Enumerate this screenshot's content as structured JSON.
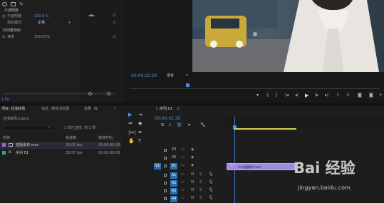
{
  "effect_controls": {
    "opacity_label": "不透明度",
    "opacity_prop": "不透明度",
    "opacity_value": "100.0 %",
    "blend_label": "混合模式",
    "blend_value": "正常",
    "time_remap_label": "时间重映射",
    "speed_label": "速度",
    "speed_value": "100.00%",
    "bottom_time": "1:00"
  },
  "program_monitor": {
    "timecode": "00:00:02:20",
    "fit_label": "适合"
  },
  "project": {
    "tabs": [
      "项目: 丝滑转场",
      "信息",
      "媒体浏览器",
      "效果",
      "库"
    ],
    "path": "丝滑转场.prproj",
    "item_count": "1 项已选择, 共 2 项",
    "col_name": "名称",
    "col_fps": "帧速率",
    "col_start": "媒体开始",
    "items": [
      {
        "name": "拍摄素材.mov",
        "fps": "25.00 fps",
        "start": "00:00:00:00",
        "color": "#8a6fd1"
      },
      {
        "name": "序列 01",
        "fps": "29.97 fps",
        "start": "00:00:00:00",
        "color": "#2aa7a0"
      }
    ]
  },
  "timeline": {
    "tab_label": "序列 01",
    "timecode": "00:00:02:20",
    "clip_label": "fx  拍摄素材.mov",
    "video_tracks": [
      "V3",
      "V2",
      "V1"
    ],
    "audio_tracks": [
      "A1",
      "A2",
      "A3",
      "A4",
      "A5"
    ],
    "source_patch": "V1"
  },
  "watermark": {
    "brand": "Bai 经验",
    "url": "jingyan.baidu.com"
  },
  "colors": {
    "accent": "#4a8de0",
    "clip": "#9d8be0",
    "workarea": "#d9d24a"
  }
}
